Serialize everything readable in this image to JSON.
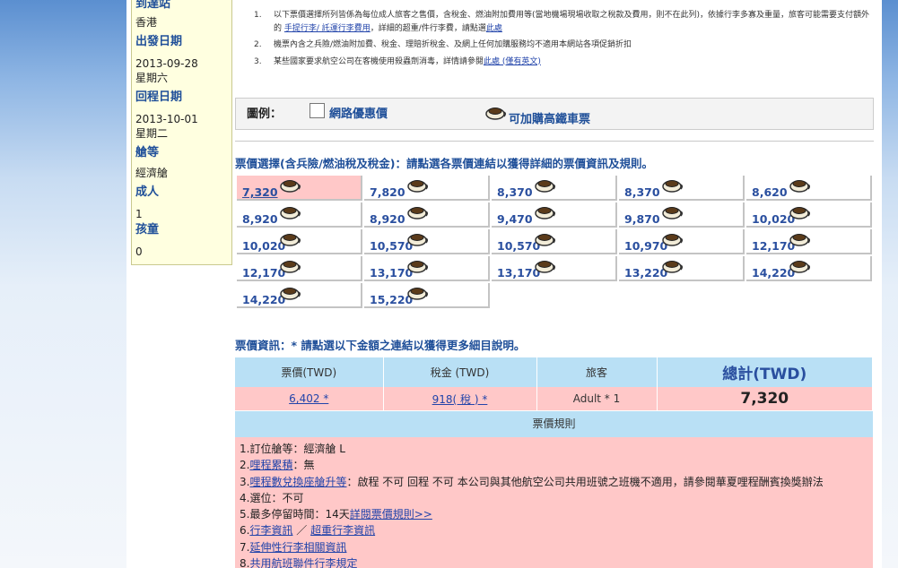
{
  "sidebar": {
    "arrival_label": "到達站",
    "arrival_value": "香港",
    "depart_label": "出發日期",
    "depart_date": "2013-09-28",
    "depart_weekday": "星期六",
    "return_label": "回程日期",
    "return_date": "2013-10-01",
    "return_weekday": "星期二",
    "cabin_label": "艙等",
    "cabin_value": "經濟艙",
    "adult_label": "成人",
    "adult_value": "1",
    "child_label": "孩童",
    "child_value": "0"
  },
  "notes": {
    "n1_num": "1.",
    "n1_text": "以下票價選擇所列皆係為每位成人旅客之售價，含稅金、燃油附加費用等(當地機場現場收取之稅款及費用，則不在此列)，依據行李多寡及重量，旅客可能需要支付額外的",
    "n1_link1": "手提行李/ 託運行李費用",
    "n1_mid": "，詳細的超重/件行李費，請點選",
    "n1_link2": "此處",
    "n2_num": "2.",
    "n2_text": "機票內含之兵險/燃油附加費、稅金、理賠折稅金、及網上任何加購服務均不適用本網站各項促銷折扣",
    "n3_num": "3.",
    "n3_text": "某些國家要求航空公司在客機使用殺蟲劑消毒，詳情請參閱",
    "n3_link": "此處 (僅有英文)"
  },
  "legend": {
    "title": "圖例：",
    "net_fare": "網路優惠價",
    "hsr": "可加購高鐵車票"
  },
  "fare_selection_title": "票價選擇(含兵險/燃油稅及稅金)：請點選各票價連結以獲得詳細的票價資訊及規則。",
  "fares": [
    "7,320",
    "7,820",
    "8,370",
    "8,370",
    "8,620",
    "8,920",
    "8,920",
    "9,470",
    "9,870",
    "10,020",
    "10,020",
    "10,570",
    "10,570",
    "10,970",
    "12,170",
    "12,170",
    "13,170",
    "13,170",
    "13,220",
    "14,220",
    "14,220",
    "15,220"
  ],
  "selected_fare_index": 0,
  "fare_info_title": "票價資訊：* 請點選以下金額之連結以獲得更多細目說明。",
  "fare_table": {
    "headers": [
      "票價(TWD)",
      "稅金 (TWD)",
      "旅客",
      "總計(TWD)"
    ],
    "fare": "6,402 *",
    "tax": "918( 稅 ) *",
    "passenger": "Adult * 1",
    "total": "7,320"
  },
  "rules_title": "票價規則",
  "rules": {
    "r1": "1.訂位艙等：經濟艙 L",
    "r2_num": "2.",
    "r2_link": "哩程累積",
    "r2_text": "：無",
    "r3_num": "3.",
    "r3_link": "哩程數兌換座艙升等",
    "r3_text": "：啟程 不可 回程 不可 本公司與其他航空公司共用班號之班機不適用，請參閱華夏哩程酬賓換獎辦法",
    "r4": "4.選位：不可",
    "r5_text": "5.最多停留時間：14天",
    "r5_link": "詳閱票價規則>>",
    "r6_num": "6.",
    "r6_link1": "行李資訊",
    "r6_sep": " ／ ",
    "r6_link2": "超重行李資訊",
    "r7_num": "7.",
    "r7_link": "延伸性行李相關資訊",
    "r8_num": "8.",
    "r8_link": "共用航班聯件行李規定"
  },
  "icons": {
    "fare_icon": "coffee-cup-icon",
    "checkbox": "checkbox-icon"
  },
  "colors": {
    "selected_fare_bg": "#ffc8c8",
    "header_bg": "#b9e0f5",
    "link": "#2a4f9f"
  }
}
